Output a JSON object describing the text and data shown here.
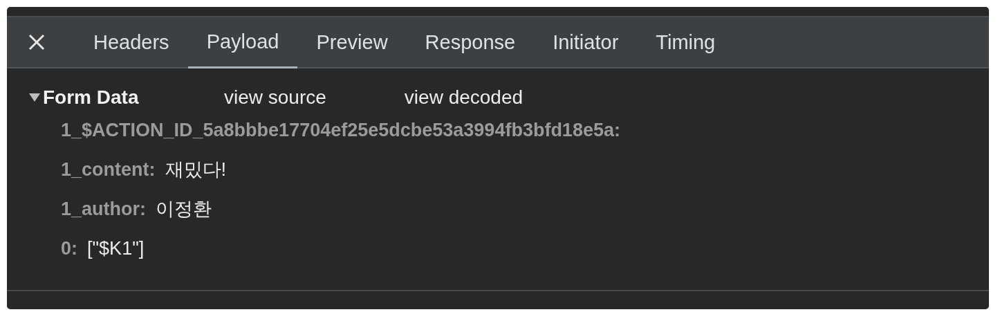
{
  "tabs": [
    {
      "label": "Headers",
      "selected": false
    },
    {
      "label": "Payload",
      "selected": true
    },
    {
      "label": "Preview",
      "selected": false
    },
    {
      "label": "Response",
      "selected": false
    },
    {
      "label": "Initiator",
      "selected": false
    },
    {
      "label": "Timing",
      "selected": false
    }
  ],
  "section": {
    "title": "Form Data",
    "expanded": true,
    "links": [
      "view source",
      "view decoded"
    ],
    "fields": [
      {
        "key": "1_$ACTION_ID_5a8bbbe17704ef25e5dcbe53a3994fb3bfd18e5a:"
      },
      {
        "key": "1_content:",
        "value": "재밌다!"
      },
      {
        "key": "1_author:",
        "value": "이정환"
      },
      {
        "key": "0:",
        "value": "[\"$K1\"]"
      }
    ]
  }
}
